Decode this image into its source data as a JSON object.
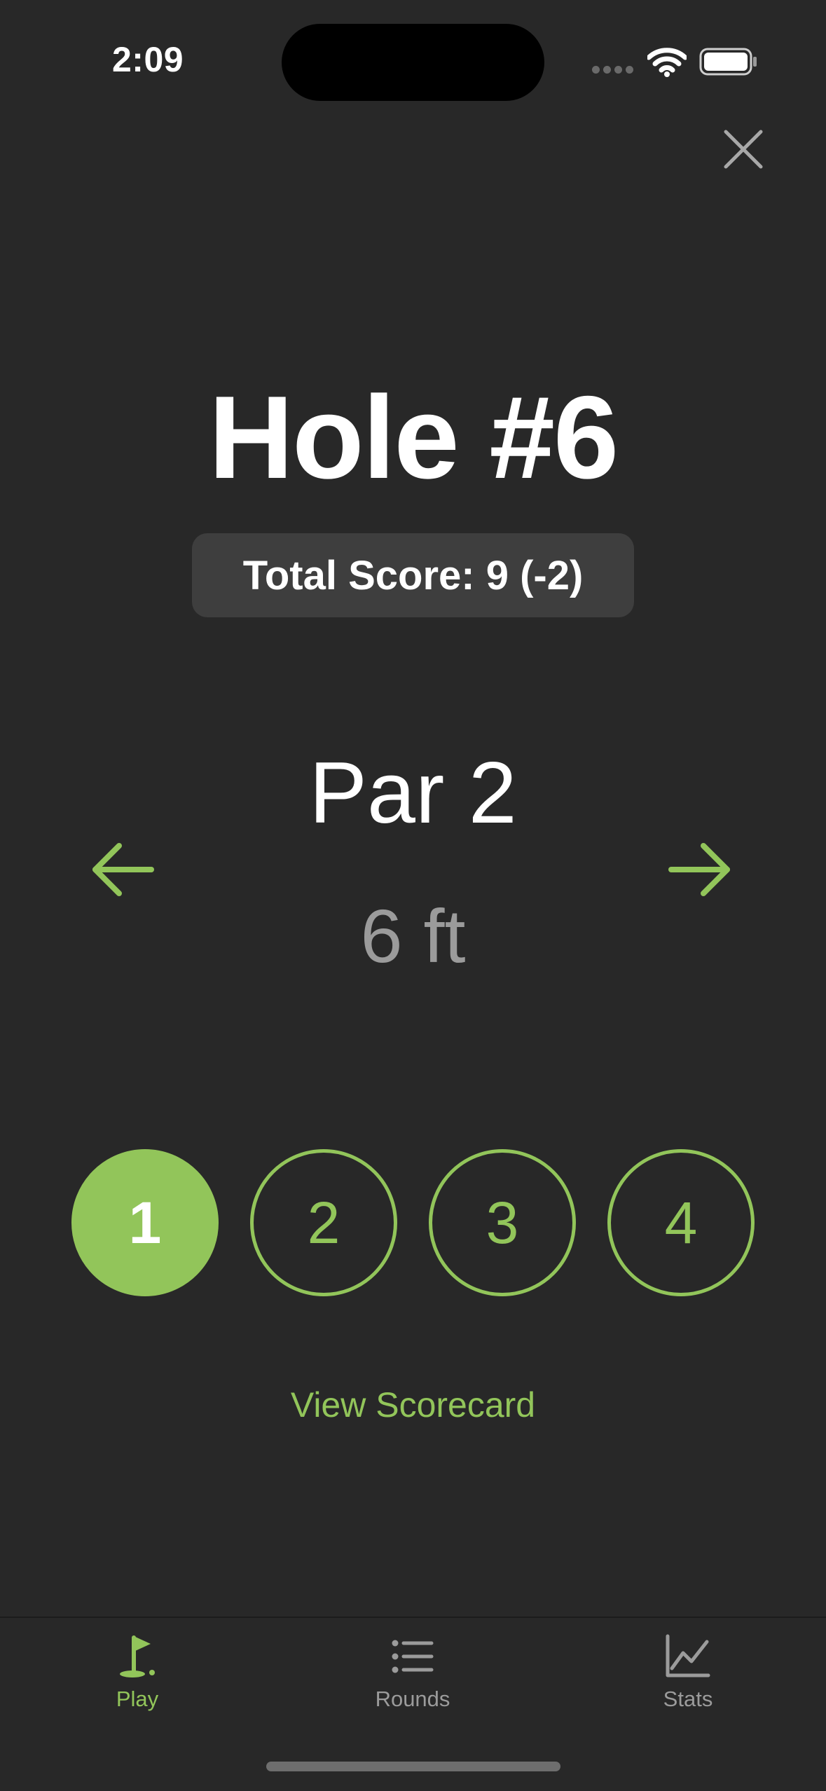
{
  "status_bar": {
    "time": "2:09",
    "icons": [
      "cellular-signal-icon",
      "wifi-icon",
      "battery-icon"
    ]
  },
  "header": {
    "close_icon": "close-icon",
    "hole_title": "Hole #6",
    "total_score": "Total Score: 9 (-2)"
  },
  "hole_info": {
    "par": "Par 2",
    "distance": "6 ft",
    "prev_icon": "arrow-left-icon",
    "next_icon": "arrow-right-icon"
  },
  "strokes": {
    "options": [
      "1",
      "2",
      "3",
      "4"
    ],
    "selected": "1"
  },
  "links": {
    "view_scorecard": "View Scorecard"
  },
  "tab_bar": {
    "tabs": [
      {
        "label": "Play",
        "icon": "golf-flag-icon",
        "active": true
      },
      {
        "label": "Rounds",
        "icon": "list-icon",
        "active": false
      },
      {
        "label": "Stats",
        "icon": "line-chart-icon",
        "active": false
      }
    ]
  },
  "colors": {
    "background": "#282828",
    "accent": "#92c55a",
    "badge": "#3e3e3e",
    "muted_text": "#9b9b9b"
  }
}
